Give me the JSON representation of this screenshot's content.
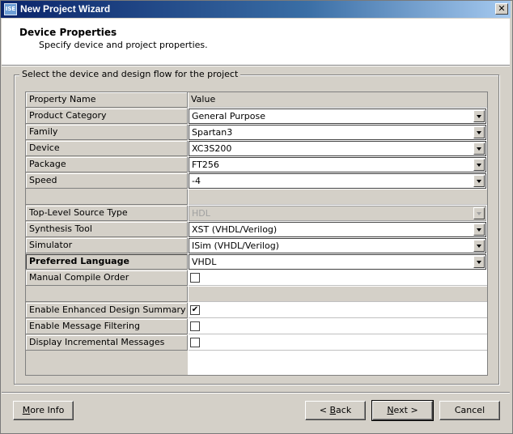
{
  "window": {
    "title": "New Project Wizard",
    "icon": "ISE"
  },
  "header": {
    "title": "Device Properties",
    "subtitle": "Specify device and project properties."
  },
  "group": {
    "legend": "Select the device and design flow for the project"
  },
  "table": {
    "header": {
      "name": "Property Name",
      "value": "Value"
    },
    "rows": [
      {
        "name": "Product Category",
        "value": "General Purpose"
      },
      {
        "name": "Family",
        "value": "Spartan3"
      },
      {
        "name": "Device",
        "value": "XC3S200"
      },
      {
        "name": "Package",
        "value": "FT256"
      },
      {
        "name": "Speed",
        "value": "-4"
      },
      {
        "name": "Top-Level Source Type",
        "value": "HDL"
      },
      {
        "name": "Synthesis Tool",
        "value": "XST (VHDL/Verilog)"
      },
      {
        "name": "Simulator",
        "value": "ISim (VHDL/Verilog)"
      },
      {
        "name": "Preferred Language",
        "value": "VHDL"
      },
      {
        "name": "Manual Compile Order",
        "checked": false
      },
      {
        "name": "Enable Enhanced Design Summary",
        "checked": true
      },
      {
        "name": "Enable Message Filtering",
        "checked": false
      },
      {
        "name": "Display Incremental Messages",
        "checked": false
      }
    ]
  },
  "buttons": {
    "more_info": {
      "pre": "",
      "u": "M",
      "post": "ore Info"
    },
    "back": {
      "pre": "< ",
      "u": "B",
      "post": "ack"
    },
    "next": {
      "pre": "",
      "u": "N",
      "post": "ext >"
    },
    "cancel": {
      "label": "Cancel"
    }
  },
  "check_mark": "✔",
  "close_glyph": "✕"
}
